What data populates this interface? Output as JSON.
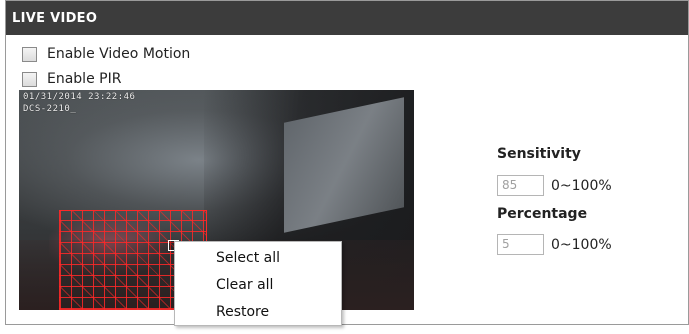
{
  "panel": {
    "title": "LIVE VIDEO"
  },
  "options": {
    "video_motion_label": "Enable Video Motion",
    "pir_label": "Enable PIR"
  },
  "video": {
    "osd_line1": "01/31/2014 23:22:46",
    "osd_line2": "DCS-2210_"
  },
  "context_menu": {
    "items": [
      "Select all",
      "Clear all",
      "Restore"
    ]
  },
  "sensitivity": {
    "label": "Sensitivity",
    "value": "85",
    "range": "0~100%"
  },
  "percentage": {
    "label": "Percentage",
    "value": "5",
    "range": "0~100%"
  },
  "colors": {
    "header_bg": "#3c3c3c",
    "grid_red": "#ff2828"
  }
}
